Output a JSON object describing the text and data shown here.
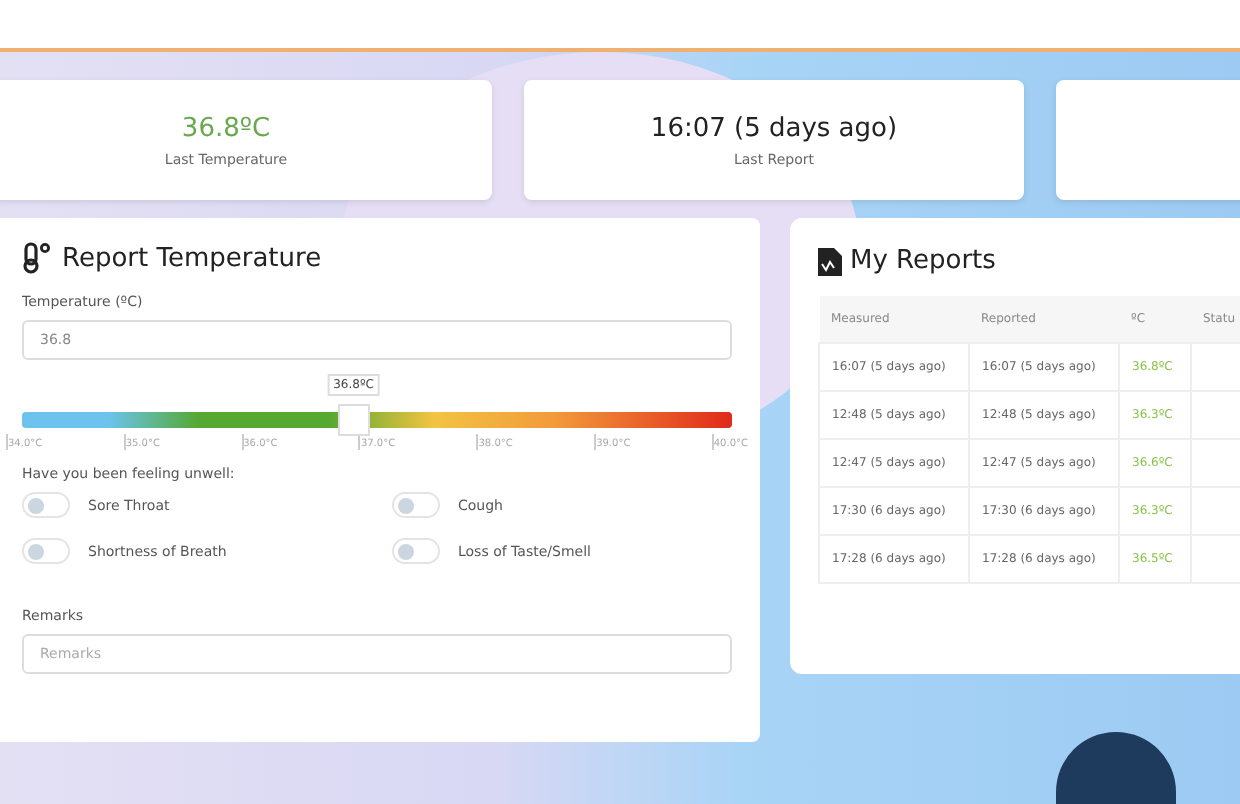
{
  "stats": [
    {
      "value": "36.8ºC",
      "label": "Last Temperature",
      "kind": "temperature"
    },
    {
      "value": "16:07 (5 days ago)",
      "label": "Last Report",
      "kind": "plain"
    },
    {
      "kind": "empty"
    }
  ],
  "report_form": {
    "title": "Report Temperature",
    "temperature_label": "Temperature (ºC)",
    "temperature_value": "36.8",
    "slider": {
      "level": 0.467,
      "tooltip": "36.8ºC",
      "ticks": [
        "34.0°C",
        "35.0°C",
        "36.0°C",
        "37.0°C",
        "38.0°C",
        "39.0°C",
        "40.0°C"
      ]
    },
    "symptoms_label": "Have you been feeling unwell:",
    "symptoms": [
      {
        "label": "Sore Throat",
        "on": false
      },
      {
        "label": "Cough",
        "on": false
      },
      {
        "label": "Shortness of Breath",
        "on": false
      },
      {
        "label": "Loss of Taste/Smell",
        "on": false
      }
    ],
    "remarks_label": "Remarks",
    "remarks_placeholder": "Remarks"
  },
  "reports": {
    "title": "My Reports",
    "columns": [
      "Measured",
      "Reported",
      "ºC",
      "Statu"
    ],
    "rows": [
      [
        "16:07 (5 days ago)",
        "16:07 (5 days ago)",
        "36.8ºC"
      ],
      [
        "12:48 (5 days ago)",
        "12:48 (5 days ago)",
        "36.3ºC"
      ],
      [
        "12:47 (5 days ago)",
        "12:47 (5 days ago)",
        "36.6ºC"
      ],
      [
        "17:30 (6 days ago)",
        "17:30 (6 days ago)",
        "36.3ºC"
      ],
      [
        "17:28 (6 days ago)",
        "17:28 (6 days ago)",
        "36.5ºC"
      ]
    ]
  }
}
